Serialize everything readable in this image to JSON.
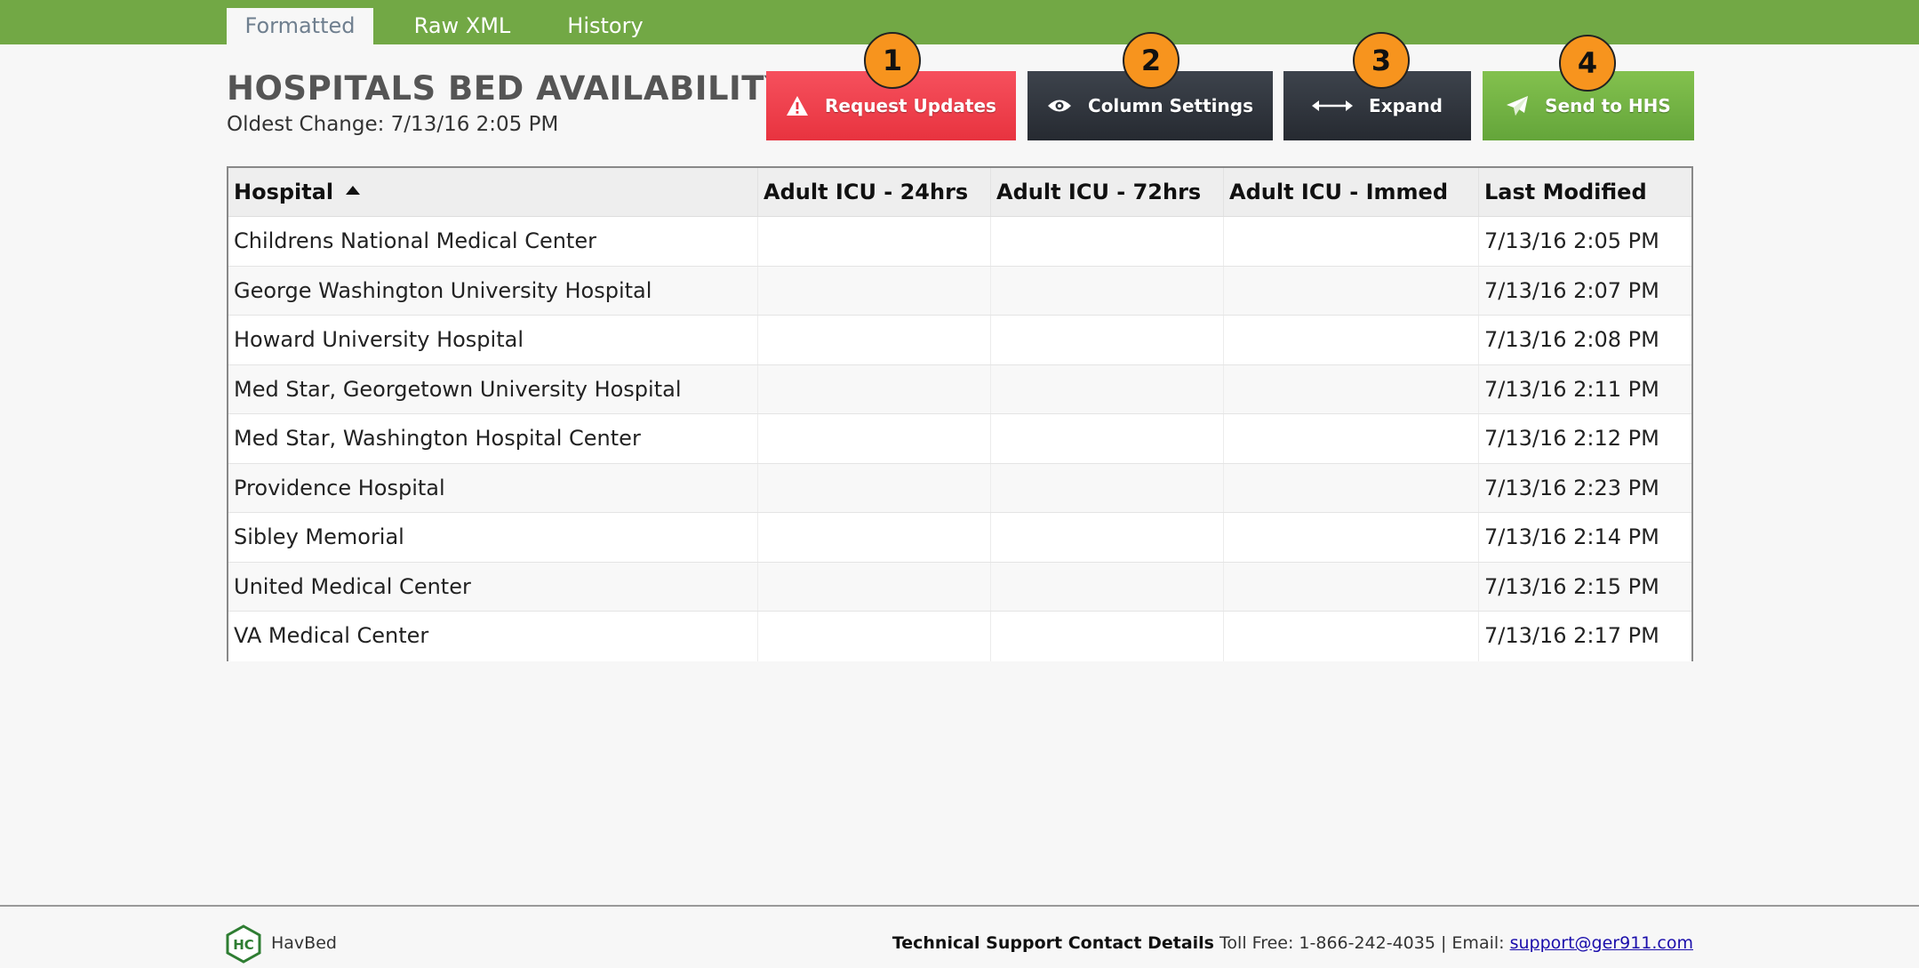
{
  "tabs": [
    "Formatted",
    "Raw XML",
    "History"
  ],
  "header": {
    "title": "HOSPITALS BED AVAILABILITY",
    "oldest_change": "Oldest Change: 7/13/16 2:05 PM"
  },
  "toolbar": {
    "request_updates": "Request Updates",
    "column_settings": "Column Settings",
    "expand": "Expand",
    "send_to_hhs": "Send to HHS"
  },
  "badges": [
    "1",
    "2",
    "3",
    "4"
  ],
  "table": {
    "columns": [
      "Hospital",
      "Adult ICU - 24hrs",
      "Adult ICU - 72hrs",
      "Adult ICU - Immed",
      "Last Modified"
    ],
    "rows": [
      [
        "Childrens National Medical Center",
        "",
        "",
        "",
        "7/13/16 2:05 PM"
      ],
      [
        "George Washington University Hospital",
        "",
        "",
        "",
        "7/13/16 2:07 PM"
      ],
      [
        "Howard University Hospital",
        "",
        "",
        "",
        "7/13/16 2:08 PM"
      ],
      [
        "Med Star, Georgetown University Hospital",
        "",
        "",
        "",
        "7/13/16 2:11 PM"
      ],
      [
        "Med Star, Washington Hospital Center",
        "",
        "",
        "",
        "7/13/16 2:12 PM"
      ],
      [
        "Providence Hospital",
        "",
        "",
        "",
        "7/13/16 2:23 PM"
      ],
      [
        "Sibley Memorial",
        "",
        "",
        "",
        "7/13/16 2:14 PM"
      ],
      [
        "United Medical Center",
        "",
        "",
        "",
        "7/13/16 2:15 PM"
      ],
      [
        "VA Medical Center",
        "",
        "",
        "",
        "7/13/16 2:17 PM"
      ]
    ]
  },
  "footer": {
    "brand": "HavBed",
    "logo_text": "HC",
    "support_label": "Technical Support Contact Details",
    "support_phone": "Toll Free: 1-866-242-4035 | Email:",
    "support_email": "support@ger911.com"
  },
  "colors": {
    "topbar": "#72a845",
    "request_updates": "#f04452",
    "dark_button": "#2f343b",
    "send_button": "#74b345",
    "badge": "#f7941e"
  }
}
